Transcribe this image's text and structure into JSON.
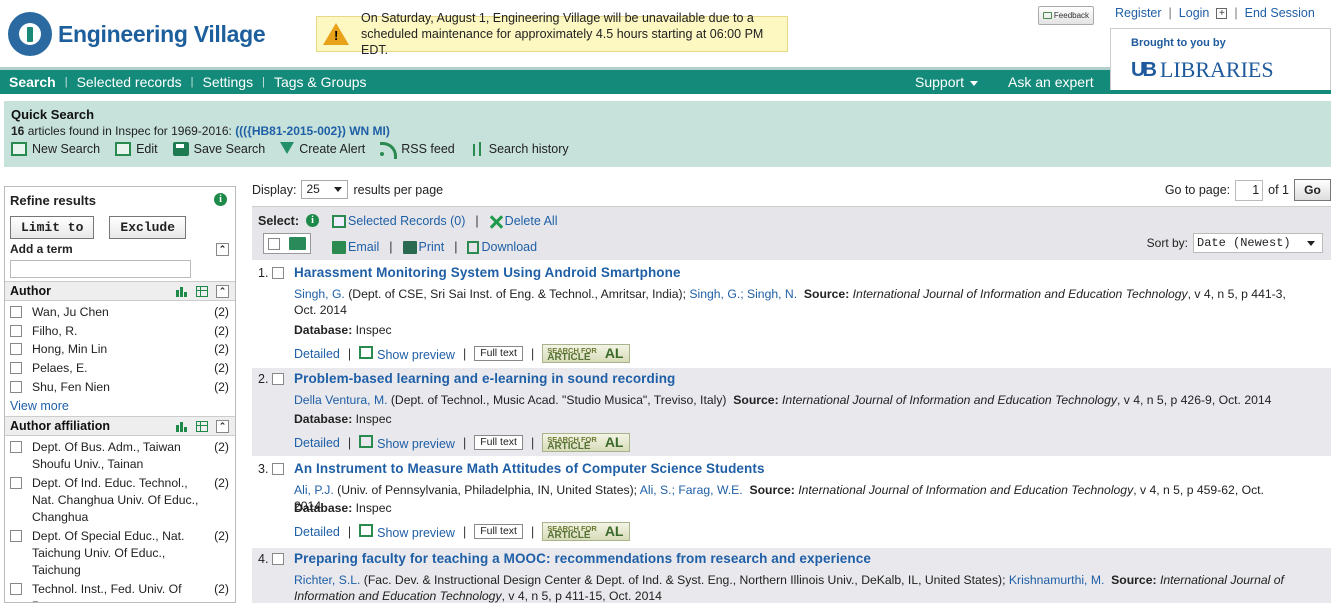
{
  "header": {
    "logo_text": "Engineering Village",
    "maintenance_msg": "On Saturday, August 1, Engineering Village will be unavailable due to a scheduled maintenance for approximately 4.5 hours starting at 06:00 PM EDT.",
    "feedback_label": "Feedback",
    "register": "Register",
    "login": "Login",
    "end_session": "End Session",
    "sponsor_by": "Brought to you by",
    "sponsor_ub": "UB",
    "sponsor_name": "LIBRARIES"
  },
  "nav": {
    "items": [
      "Search",
      "Selected records",
      "Settings",
      "Tags & Groups"
    ],
    "support": "Support",
    "ask_expert": "Ask an expert"
  },
  "quick_search": {
    "title": "Quick Search",
    "count": "16",
    "found_text": "articles found in Inspec for 1969-2016:",
    "query": "((({HB81-2015-002}) WN MI)",
    "actions": [
      "New Search",
      "Edit",
      "Save Search",
      "Create Alert",
      "RSS feed",
      "Search history"
    ]
  },
  "refine": {
    "title": "Refine results",
    "limit_to": "Limit to",
    "exclude": "Exclude",
    "add_term": "Add a term",
    "author_title": "Author",
    "authors": [
      {
        "name": "Wan, Ju Chen",
        "count": "(2)"
      },
      {
        "name": "Filho, R.",
        "count": "(2)"
      },
      {
        "name": "Hong, Min Lin",
        "count": "(2)"
      },
      {
        "name": "Pelaes, E.",
        "count": "(2)"
      },
      {
        "name": "Shu, Fen Nien",
        "count": "(2)"
      }
    ],
    "view_more": "View more",
    "affiliation_title": "Author affiliation",
    "affiliations": [
      {
        "name": "Dept. Of Bus. Adm., Taiwan Shoufu Univ., Tainan",
        "count": "(2)"
      },
      {
        "name": "Dept. Of Ind. Educ. Technol., Nat. Changhua Univ. Of Educ., Changhua",
        "count": "(2)"
      },
      {
        "name": "Dept. Of Special Educ., Nat. Taichung Univ. Of Educ., Taichung",
        "count": "(2)"
      },
      {
        "name": "Technol. Inst., Fed. Univ. Of Para,",
        "count": "(2)"
      }
    ]
  },
  "results_bar": {
    "display_label": "Display:",
    "display_value": "25",
    "per_page": "results per page",
    "goto_label": "Go to page:",
    "page": "1",
    "of": "of 1",
    "go": "Go",
    "select_label": "Select:",
    "selected_records": "Selected Records (0)",
    "delete_all": "Delete All",
    "email": "Email",
    "print": "Print",
    "download": "Download",
    "sort_label": "Sort by:",
    "sort_value": "Date (Newest)"
  },
  "results": [
    {
      "num": "1.",
      "title": "Harassment Monitoring System Using Android Smartphone",
      "authors_pre": "Singh, G.",
      "affil": "(Dept. of CSE, Sri Sai Inst. of Eng. & Technol., Amritsar, India);",
      "authors_post": "Singh, G.; Singh, N.",
      "source_label": "Source:",
      "journal": "International Journal of Information and Education Technology",
      "details": ", v 4, n 5, p 441-3, Oct. 2014",
      "db_label": "Database:",
      "db": "Inspec"
    },
    {
      "num": "2.",
      "title": "Problem-based learning and e-learning in sound recording",
      "authors_pre": "Della Ventura, M.",
      "affil": "(Dept. of Technol., Music Acad. \"Studio Musica\", Treviso, Italy)",
      "authors_post": "",
      "source_label": "Source:",
      "journal": "International Journal of Information and Education Technology",
      "details": ", v 4, n 5, p 426-9, Oct. 2014",
      "db_label": "Database:",
      "db": "Inspec"
    },
    {
      "num": "3.",
      "title": "An Instrument to Measure Math Attitudes of Computer Science Students",
      "authors_pre": "Ali, P.J.",
      "affil": "(Univ. of Pennsylvania, Philadelphia, IN, United States);",
      "authors_post": "Ali, S.; Farag, W.E.",
      "source_label": "Source:",
      "journal": "International Journal of Information and Education Technology",
      "details": ", v 4, n 5, p 459-62, Oct. 2014",
      "db_label": "Database:",
      "db": "Inspec"
    },
    {
      "num": "4.",
      "title": "Preparing faculty for teaching a MOOC: recommendations from research and experience",
      "authors_pre": "Richter, S.L.",
      "affil": "(Fac. Dev. & Instructional Design Center & Dept. of Ind. & Syst. Eng., Northern Illinois Univ., DeKalb, IL, United States);",
      "authors_post": "Krishnamurthi, M.",
      "source_label": "Source:",
      "journal": "International Journal of Information and Education Technology",
      "details": ", v 4, n 5, p 411-15, Oct. 2014",
      "db_label": "",
      "db": ""
    }
  ],
  "result_links": {
    "detailed": "Detailed",
    "show_preview": "Show preview",
    "full_text": "Full text",
    "search_for": "SEARCH FOR",
    "article": "ARTICLE",
    "al": "AL"
  }
}
